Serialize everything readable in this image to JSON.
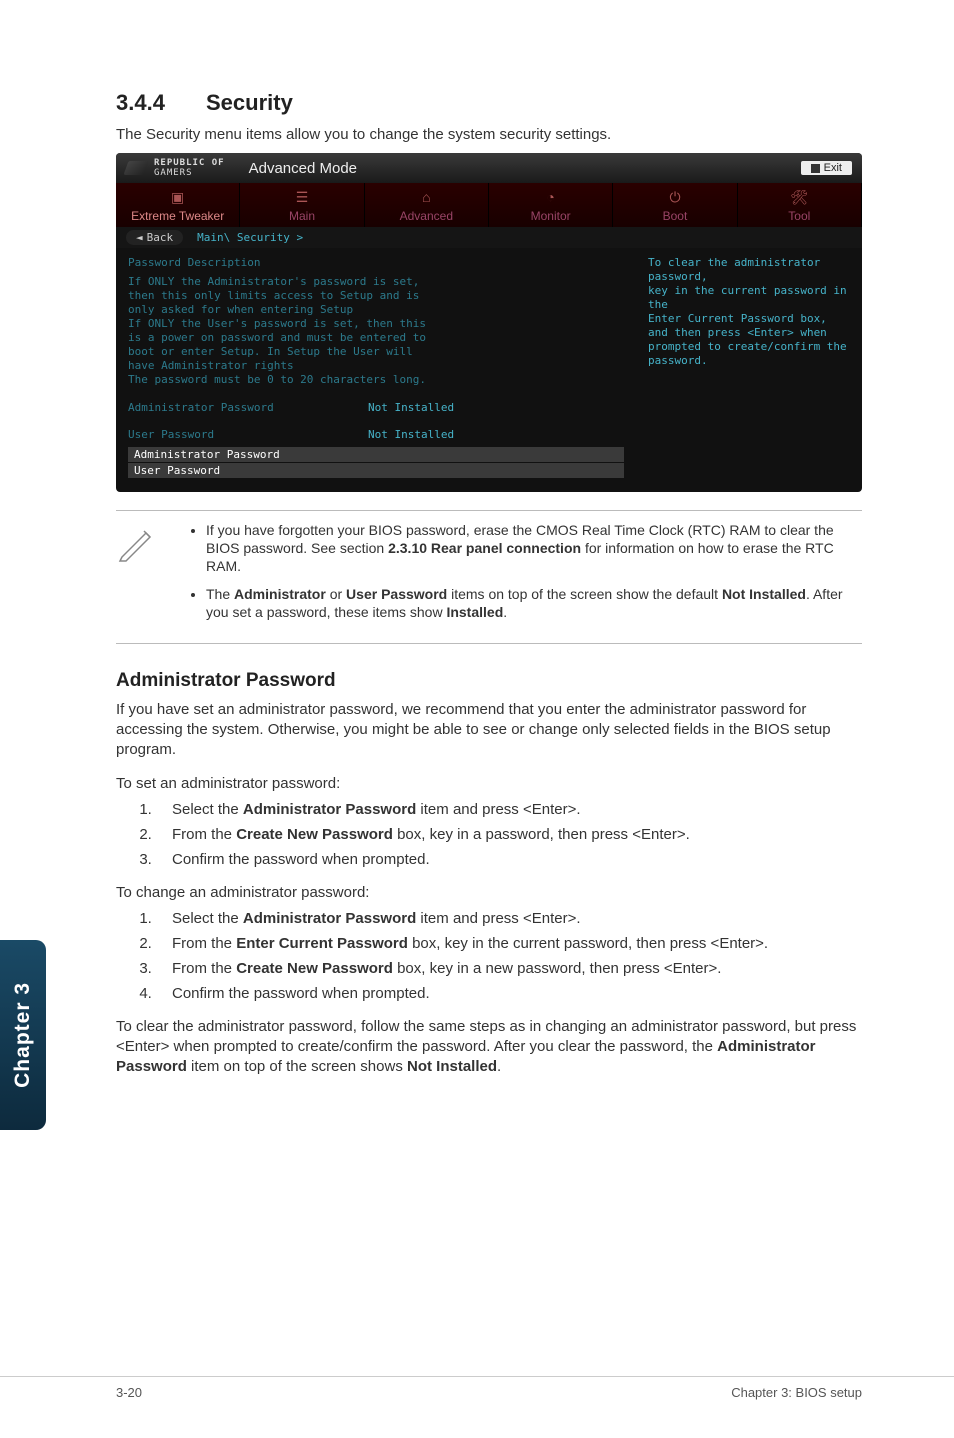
{
  "section": {
    "number": "3.4.4",
    "title": "Security"
  },
  "lead": "The Security menu items allow you to change the system security settings.",
  "bios": {
    "brand_l1": "REPUBLIC OF",
    "brand_l2": "GAMERS",
    "mode": "Advanced Mode",
    "exit": "Exit",
    "tabs": [
      {
        "label": "Extreme Tweaker"
      },
      {
        "label": "Main"
      },
      {
        "label": "Advanced"
      },
      {
        "label": "Monitor"
      },
      {
        "label": "Boot"
      },
      {
        "label": "Tool"
      }
    ],
    "back": "Back",
    "crumb": "Main\\ Security >",
    "desc_title": "Password Description",
    "desc_lines": [
      "If ONLY the Administrator's password is set,",
      "then this only limits access to Setup and is",
      "only asked for when entering Setup",
      "If ONLY the User's password is set, then this",
      "is a power on password and must be entered to",
      "boot or enter Setup. In Setup the User will",
      "have Administrator rights",
      "The password must be 0 to 20 characters long."
    ],
    "rows": [
      {
        "k": "Administrator Password",
        "v": "Not Installed"
      },
      {
        "k": "User Password",
        "v": "Not Installed"
      }
    ],
    "sel": [
      "Administrator Password",
      "User Password"
    ],
    "help": [
      "To clear the administrator password,",
      "key in the current password in the",
      "Enter Current Password box,",
      "and then press <Enter> when",
      "prompted to create/confirm the",
      "password."
    ]
  },
  "notes": {
    "n1_a": "If you have forgotten your BIOS password, erase the CMOS Real Time Clock (RTC) RAM to clear the BIOS password. See section ",
    "n1_b": "2.3.10 Rear panel connection",
    "n1_c": " for information on how to erase the RTC RAM.",
    "n2_a": "The ",
    "n2_b": "Administrator",
    "n2_c": " or ",
    "n2_d": "User Password",
    "n2_e": " items on top of the screen show the default ",
    "n2_f": "Not Installed",
    "n2_g": ". After you set a password, these items show ",
    "n2_h": "Installed",
    "n2_i": "."
  },
  "admin": {
    "heading": "Administrator Password",
    "intro": "If you have set an administrator password, we recommend that you enter the administrator password for accessing the system. Otherwise, you might be able to see or change only selected fields in the BIOS setup program.",
    "set_title": "To set an administrator password:",
    "set_steps": {
      "s1a": "Select the ",
      "s1b": "Administrator Password",
      "s1c": " item and press <Enter>.",
      "s2a": "From the ",
      "s2b": "Create New Password",
      "s2c": " box, key in a password, then press <Enter>.",
      "s3": "Confirm the password when prompted."
    },
    "change_title": "To change an administrator password:",
    "change_steps": {
      "s1a": "Select the ",
      "s1b": "Administrator Password",
      "s1c": " item and press <Enter>.",
      "s2a": "From the ",
      "s2b": "Enter Current Password",
      "s2c": " box, key in the current password, then press <Enter>.",
      "s3a": "From the ",
      "s3b": "Create New Password",
      "s3c": " box, key in a new password, then press <Enter>.",
      "s4": "Confirm the password when prompted."
    },
    "clear_a": "To clear the administrator password, follow the same steps as in changing an administrator password, but press <Enter> when prompted to create/confirm the password. After you clear the password, the ",
    "clear_b": "Administrator Password",
    "clear_c": " item on top of the screen shows ",
    "clear_d": "Not Installed",
    "clear_e": "."
  },
  "side_tab": "Chapter 3",
  "footer": {
    "left": "3-20",
    "right": "Chapter 3: BIOS setup"
  }
}
